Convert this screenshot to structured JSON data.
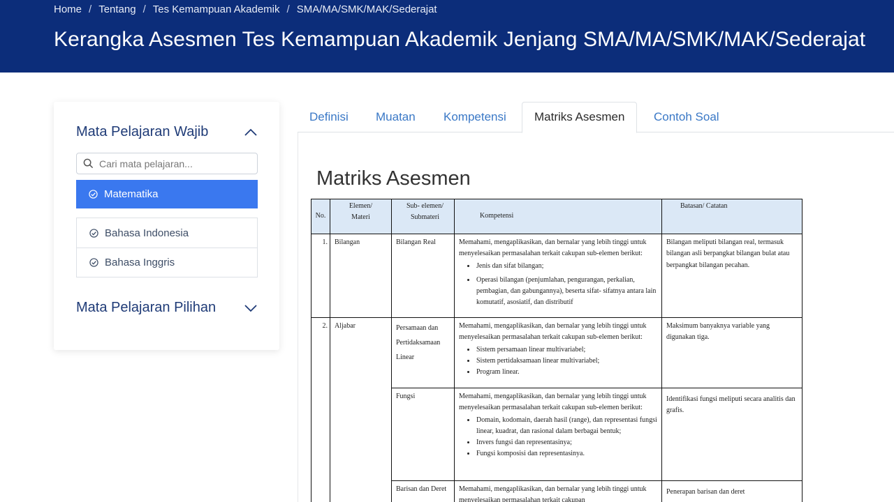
{
  "breadcrumb": [
    "Home",
    "Tentang",
    "Tes Kemampuan Akademik",
    "SMA/MA/SMK/MAK/Sederajat"
  ],
  "page_title": "Kerangka Asesmen Tes Kemampuan Akademik Jenjang SMA/MA/SMK/MAK/Sederajat",
  "sidebar": {
    "wajib_title": "Mata Pelajaran Wajib",
    "search_placeholder": "Cari mata pelajaran...",
    "subjects": [
      {
        "label": "Matematika",
        "active": true
      },
      {
        "label": "Bahasa Indonesia",
        "active": false
      },
      {
        "label": "Bahasa Inggris",
        "active": false
      }
    ],
    "pilihan_title": "Mata Pelajaran Pilihan"
  },
  "tabs": [
    "Definisi",
    "Muatan",
    "Kompetensi",
    "Matriks Asesmen",
    "Contoh Soal"
  ],
  "active_tab": "Matriks Asesmen",
  "section_title": "Matriks Asesmen",
  "table": {
    "headers": {
      "no": "No.",
      "elemen": "Elemen/ Materi",
      "sub": "Sub- elemen/ Submateri",
      "kompetensi": "Kompetensi",
      "batasan": "Batasan/ Catatan"
    },
    "rows": [
      {
        "no": "1.",
        "elemen": "Bilangan",
        "sub": "Bilangan Real",
        "kompetensi": "Memahami, mengaplikasikan, dan bernalar yang lebih tinggi untuk menyelesaikan permasalahan terkait cakupan sub-elemen berikut:",
        "bullets": [
          "Jenis dan sifat bilangan;",
          "Operasi bilangan (penjumlahan, pengurangan, perkalian, pembagian, dan gabungannya), beserta sifat- sifatnya antara lain komutatif, asosiatif, dan distributif"
        ],
        "batasan": "Bilangan meliputi bilangan real, termasuk bilangan asli berpangkat bilangan bulat atau berpangkat bilangan pecahan."
      },
      {
        "no": "2.",
        "elemen": "Aljabar",
        "sub": "Persamaan dan Pertidaksamaan Linear",
        "kompetensi": "Memahami, mengaplikasikan, dan bernalar yang lebih tinggi untuk menyelesaikan permasalahan terkait cakupan sub-elemen berikut:",
        "bullets": [
          "Sistem persamaan linear multivariabel;",
          "Sistem pertidaksamaan linear multivariabel;",
          "Program linear."
        ],
        "batasan": "Maksimum banyaknya variable yang digunakan tiga."
      },
      {
        "sub": "Fungsi",
        "kompetensi": "Memahami, mengaplikasikan, dan bernalar yang lebih tinggi untuk menyelesaikan permasalahan terkait cakupan sub-elemen berikut:",
        "bullets": [
          "Domain, kodomain, daerah hasil (range), dan representasi fungsi linear, kuadrat, dan rasional dalam berbagai bentuk;",
          "Invers fungsi dan representasinya;",
          "Fungsi komposisi dan representasinya."
        ],
        "batasan": "Identifikasi fungsi meliputi secara analitis dan grafis."
      },
      {
        "sub": "Barisan dan Deret",
        "kompetensi": "Memahami, mengaplikasikan, dan bernalar yang lebih tinggi untuk menyelesaikan permasalahan terkait cakupan",
        "bullets": [],
        "batasan": "Penerapan barisan dan deret"
      }
    ]
  },
  "colors": {
    "banner": "#0c2d7a",
    "active_subject": "#3a78ef",
    "tab_link": "#3a78c6",
    "table_header": "#dbe8f6"
  }
}
